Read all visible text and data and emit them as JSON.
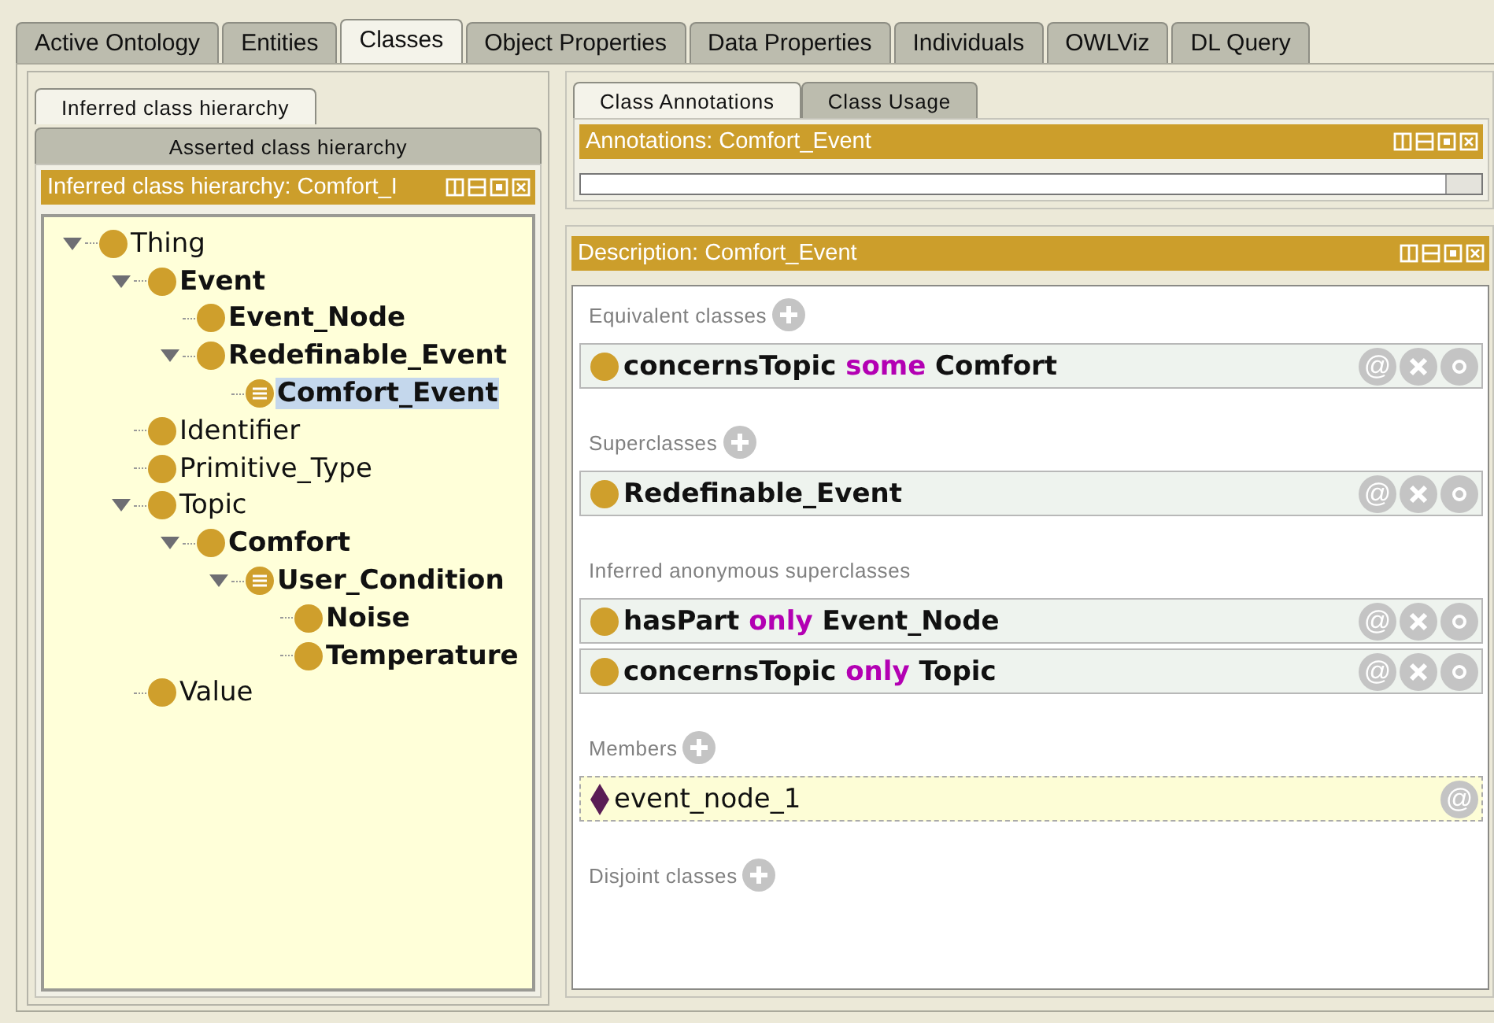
{
  "tabs": [
    {
      "label": "Active Ontology",
      "selected": false
    },
    {
      "label": "Entities",
      "selected": false
    },
    {
      "label": "Classes",
      "selected": true
    },
    {
      "label": "Object Properties",
      "selected": false
    },
    {
      "label": "Data Properties",
      "selected": false
    },
    {
      "label": "Individuals",
      "selected": false
    },
    {
      "label": "OWLViz",
      "selected": false
    },
    {
      "label": "DL Query",
      "selected": false
    }
  ],
  "hierarchy": {
    "tabs": [
      {
        "label": "Inferred class hierarchy",
        "selected": true
      },
      {
        "label": "Asserted class hierarchy",
        "selected": false
      }
    ],
    "title": "Inferred class hierarchy: Comfort_I",
    "tree": [
      {
        "label": "Thing",
        "bold": false,
        "defined": false,
        "expanded": true,
        "selected": false,
        "children": [
          {
            "label": "Event",
            "bold": true,
            "defined": false,
            "expanded": true,
            "selected": false,
            "children": [
              {
                "label": "Event_Node",
                "bold": true,
                "defined": false,
                "expanded": false,
                "selected": false
              },
              {
                "label": "Redefinable_Event",
                "bold": true,
                "defined": false,
                "expanded": true,
                "selected": false,
                "children": [
                  {
                    "label": "Comfort_Event",
                    "bold": true,
                    "defined": true,
                    "expanded": false,
                    "selected": true
                  }
                ]
              }
            ]
          },
          {
            "label": "Identifier",
            "bold": false,
            "defined": false,
            "expanded": false,
            "selected": false
          },
          {
            "label": "Primitive_Type",
            "bold": false,
            "defined": false,
            "expanded": false,
            "selected": false
          },
          {
            "label": "Topic",
            "bold": false,
            "defined": false,
            "expanded": true,
            "selected": false,
            "children": [
              {
                "label": "Comfort",
                "bold": true,
                "defined": false,
                "expanded": true,
                "selected": false,
                "children": [
                  {
                    "label": "User_Condition",
                    "bold": true,
                    "defined": true,
                    "expanded": true,
                    "selected": false,
                    "children": [
                      {
                        "label": "Noise",
                        "bold": true,
                        "defined": false,
                        "expanded": false,
                        "selected": false
                      },
                      {
                        "label": "Temperature",
                        "bold": true,
                        "defined": false,
                        "expanded": false,
                        "selected": false
                      }
                    ]
                  }
                ]
              }
            ]
          },
          {
            "label": "Value",
            "bold": false,
            "defined": false,
            "expanded": false,
            "selected": false
          }
        ]
      }
    ]
  },
  "annotations": {
    "tabs": [
      {
        "label": "Class Annotations",
        "selected": true
      },
      {
        "label": "Class Usage",
        "selected": false
      }
    ],
    "title": "Annotations: Comfort_Event"
  },
  "description": {
    "title": "Description: Comfort_Event",
    "sections": [
      {
        "label": "Equivalent classes",
        "addable": true,
        "items": [
          {
            "kind": "class",
            "parts": [
              {
                "text": "concernsTopic",
                "kind": "entity"
              },
              {
                "text": "some",
                "kind": "keyword"
              },
              {
                "text": "Comfort",
                "kind": "entity"
              }
            ],
            "actions": [
              {
                "kind": "annotate",
                "label": "@"
              },
              {
                "kind": "delete"
              },
              {
                "kind": "edit"
              }
            ]
          }
        ]
      },
      {
        "label": "Superclasses",
        "addable": true,
        "items": [
          {
            "kind": "class",
            "parts": [
              {
                "text": "Redefinable_Event",
                "kind": "entity"
              }
            ],
            "actions": [
              {
                "kind": "annotate",
                "label": "@"
              },
              {
                "kind": "delete"
              },
              {
                "kind": "edit"
              }
            ]
          }
        ]
      },
      {
        "label": "Inferred anonymous superclasses",
        "addable": false,
        "items": [
          {
            "kind": "class",
            "parts": [
              {
                "text": "hasPart",
                "kind": "entity"
              },
              {
                "text": "only",
                "kind": "keyword"
              },
              {
                "text": "Event_Node",
                "kind": "entity"
              }
            ],
            "actions": [
              {
                "kind": "annotate",
                "label": "@"
              },
              {
                "kind": "delete"
              },
              {
                "kind": "edit"
              }
            ]
          },
          {
            "kind": "class",
            "parts": [
              {
                "text": "concernsTopic",
                "kind": "entity"
              },
              {
                "text": "only",
                "kind": "keyword"
              },
              {
                "text": "Topic",
                "kind": "entity"
              }
            ],
            "actions": [
              {
                "kind": "annotate",
                "label": "@"
              },
              {
                "kind": "delete"
              },
              {
                "kind": "edit"
              }
            ]
          }
        ]
      },
      {
        "label": "Members",
        "addable": true,
        "items": [
          {
            "kind": "individual",
            "parts": [
              {
                "text": "event_node_1",
                "kind": "entity"
              }
            ],
            "actions": [
              {
                "kind": "annotate",
                "label": "@"
              }
            ]
          }
        ]
      },
      {
        "label": "Disjoint classes",
        "addable": true
      }
    ]
  }
}
